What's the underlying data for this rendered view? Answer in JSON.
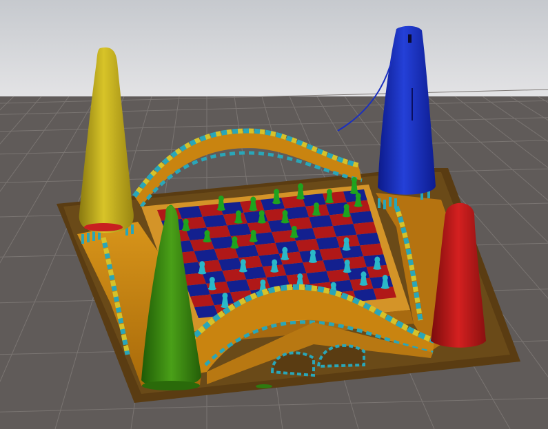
{
  "scene": {
    "description_colors": {
      "sky_top": "#c9ccd1",
      "sky_bottom": "#e6e6e8",
      "ground": "#5f5a58",
      "grid_line": "#7a7572",
      "base_plate": "#5a3c14",
      "frame_orange": "#c8860f",
      "frame_orange_dark": "#9a6008",
      "stripe_yellow": "#d6c22a",
      "stripe_cyan": "#2aa6b8",
      "board_red": "#b01818",
      "board_blue": "#13208f",
      "board_rim": "#d89a30",
      "piece_green": "#1fa31f",
      "piece_cyan": "#2ab8c8"
    },
    "towers": [
      {
        "name": "yellow-tower",
        "color": "#c8b21a"
      },
      {
        "name": "blue-tower",
        "color": "#1a2fc0"
      },
      {
        "name": "red-tower",
        "color": "#c41818"
      },
      {
        "name": "green-tower",
        "color": "#3a8a10"
      }
    ]
  }
}
